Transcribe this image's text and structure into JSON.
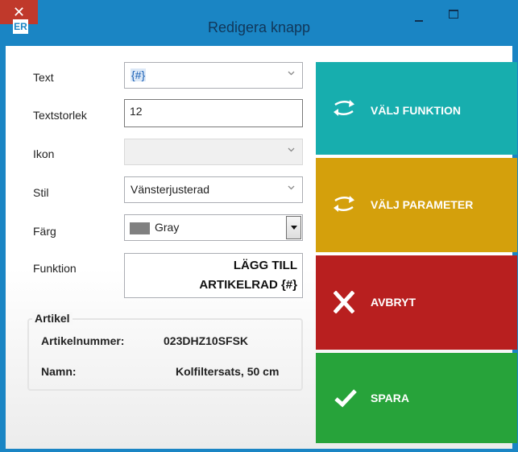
{
  "window": {
    "app_icon_text": "ER",
    "title": "Redigera knapp",
    "close_glyph": "✕"
  },
  "form": {
    "text": {
      "label": "Text",
      "value": "{#}"
    },
    "textsize": {
      "label": "Textstorlek",
      "value": "12"
    },
    "icon": {
      "label": "Ikon",
      "value": ""
    },
    "style": {
      "label": "Stil",
      "value": "Vänsterjusterad"
    },
    "color": {
      "label": "Färg",
      "value": "Gray",
      "swatch": "#808080"
    },
    "function": {
      "label": "Funktion",
      "line1": "LÄGG TILL",
      "line2": "ARTIKELRAD {#}"
    }
  },
  "article": {
    "title": "Artikel",
    "number_label": "Artikelnummer:",
    "number_value": "023DHZ10SFSK",
    "name_label": "Namn:",
    "name_value": "Kolfiltersats, 50 cm"
  },
  "actions": {
    "choose_function": {
      "label": "VÄLJ FUNKTION",
      "color": "#17aeae",
      "icon": "swap-arrows-icon"
    },
    "choose_parameter": {
      "label": "VÄLJ PARAMETER",
      "color": "#d4a00c",
      "icon": "swap-arrows-icon"
    },
    "cancel": {
      "label": "AVBRYT",
      "color": "#b81f1f",
      "icon": "x-icon"
    },
    "save": {
      "label": "SPARA",
      "color": "#27a33a",
      "icon": "checkmark-icon"
    }
  }
}
